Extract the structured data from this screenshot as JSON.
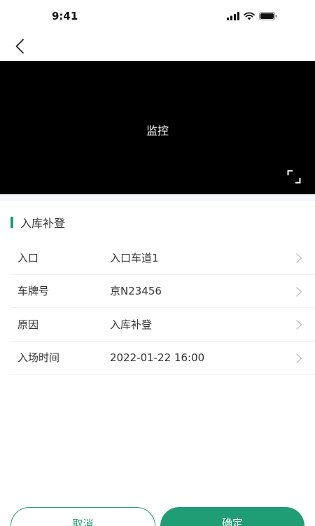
{
  "status_bar": {
    "time": "9:41"
  },
  "monitor": {
    "label": "监控"
  },
  "section": {
    "title": "入库补登"
  },
  "form": {
    "rows": [
      {
        "label": "入口",
        "value": "入口车道1"
      },
      {
        "label": "车牌号",
        "value": "京N23456"
      },
      {
        "label": "原因",
        "value": "入库补登"
      },
      {
        "label": "入场时间",
        "value": "2022-01-22 16:00"
      }
    ]
  },
  "actions": {
    "cancel_label": "取消",
    "confirm_label": "确定"
  },
  "colors": {
    "accent": "#1f9d74",
    "divider": "#f1f1f1",
    "video_bg": "#000000"
  }
}
